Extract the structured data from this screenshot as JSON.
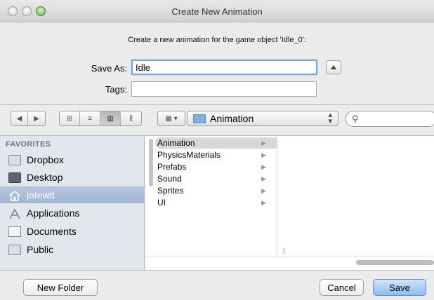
{
  "window": {
    "title": "Create New Animation"
  },
  "header": {
    "prompt": "Create a new animation for the game object 'Idle_0':",
    "save_as_label": "Save As:",
    "save_as_value": "Idle",
    "tags_label": "Tags:",
    "tags_value": ""
  },
  "toolbar": {
    "nav_back_icon": "chevron-left-icon",
    "nav_forward_icon": "chevron-right-icon",
    "view_modes": [
      "icon-view",
      "list-view",
      "column-view",
      "coverflow-view"
    ],
    "selected_view": "column-view",
    "location": "Animation",
    "search_placeholder": ""
  },
  "sidebar": {
    "section_title": "FAVORITES",
    "items": [
      {
        "label": "Dropbox",
        "icon": "folder-icon",
        "selected": false
      },
      {
        "label": "Desktop",
        "icon": "desktop-icon",
        "selected": false
      },
      {
        "label": "jatewit",
        "icon": "home-icon",
        "selected": true
      },
      {
        "label": "Applications",
        "icon": "applications-icon",
        "selected": false
      },
      {
        "label": "Documents",
        "icon": "documents-icon",
        "selected": false
      },
      {
        "label": "Public",
        "icon": "folder-icon",
        "selected": false
      }
    ]
  },
  "browser": {
    "column1": [
      {
        "label": "Animation",
        "selected": true
      },
      {
        "label": "PhysicsMaterials",
        "selected": false
      },
      {
        "label": "Prefabs",
        "selected": false
      },
      {
        "label": "Sound",
        "selected": false
      },
      {
        "label": "Sprites",
        "selected": false
      },
      {
        "label": "UI",
        "selected": false
      }
    ]
  },
  "footer": {
    "new_folder_label": "New Folder",
    "cancel_label": "Cancel",
    "save_label": "Save"
  },
  "colors": {
    "accent": "#8dbcf0",
    "sidebar_bg": "#e2e7ed",
    "sidebar_selected": "#9fb5d1"
  }
}
